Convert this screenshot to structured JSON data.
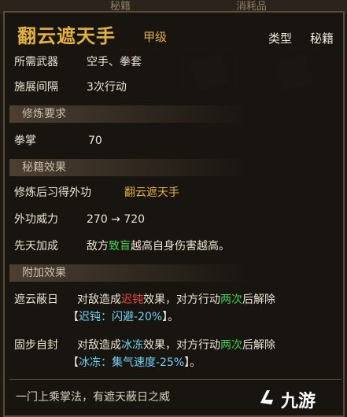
{
  "background": {
    "tabs": [
      "秘籍",
      "消耗品"
    ]
  },
  "header": {
    "title": "翻云遮天手",
    "grade": "甲级",
    "type_label": "类型",
    "type_value": "秘籍"
  },
  "info": {
    "weapon_key": "所需武器",
    "weapon_value": "空手、拳套",
    "interval_key": "施展间隔",
    "interval_value": "3次行动"
  },
  "requirements": {
    "section_title": "修炼要求",
    "skill_key": "拳掌",
    "skill_value": "70"
  },
  "effects": {
    "section_title": "秘籍效果",
    "learn_key": "修炼后习得外功",
    "learn_value": "翻云遮天手",
    "power_key": "外功威力",
    "power_value": "270 → 720",
    "innate_key": "先天加成",
    "innate_parts": [
      "敌方",
      "致盲",
      "越高自身伤害越高。"
    ]
  },
  "extra": {
    "section_title": "附加效果",
    "effect1_key": "遮云蔽日",
    "effect1_line1": [
      "对敌造成",
      "迟钝",
      "效果，对方行动",
      "两次",
      "后解除"
    ],
    "effect1_line2": [
      "【",
      "迟钝：闪避-20%",
      "】。"
    ],
    "effect2_key": "固步自封",
    "effect2_line1": [
      "对敌造成",
      "冰冻",
      "效果，对方行动",
      "两次",
      "后解除"
    ],
    "effect2_line2": [
      "【",
      "冰冻：集气速度-25%",
      "】。"
    ]
  },
  "footer": {
    "description": "一门上乘掌法，有遮天蔽日之威"
  },
  "watermark": {
    "text": "九游"
  },
  "colors": {
    "gold": "#e2b23a",
    "green": "#3fd24a",
    "red": "#f04a3a",
    "cyan": "#6fd3f0"
  }
}
